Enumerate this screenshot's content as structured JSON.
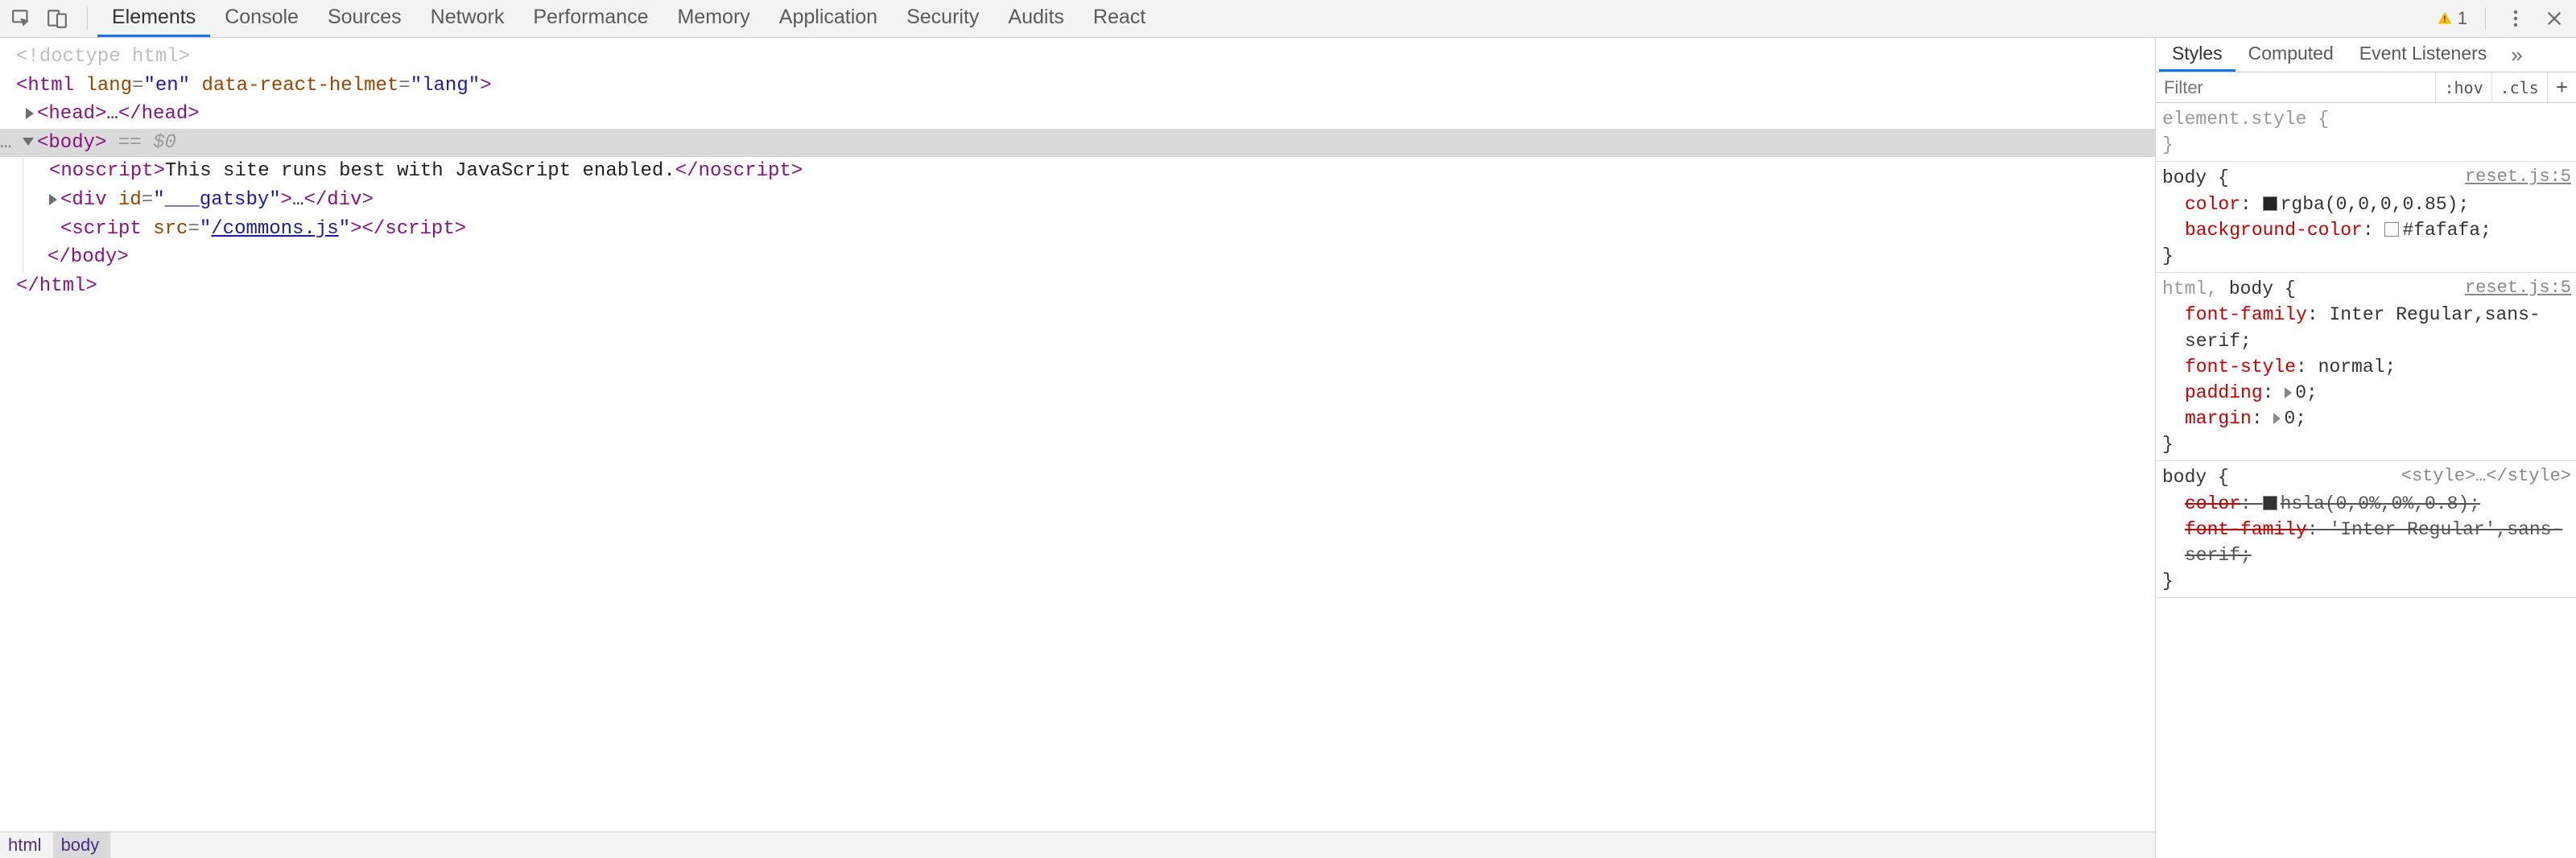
{
  "toolbar": {
    "tabs": [
      "Elements",
      "Console",
      "Sources",
      "Network",
      "Performance",
      "Memory",
      "Application",
      "Security",
      "Audits",
      "React"
    ],
    "active_tab": 0,
    "warning_count": "1"
  },
  "dom": {
    "doctype": "<!doctype html>",
    "html_open": {
      "tag": "html",
      "attrs": [
        [
          "lang",
          "en"
        ],
        [
          "data-react-helmet",
          "lang"
        ]
      ]
    },
    "head": {
      "tag": "head"
    },
    "body": {
      "tag": "body",
      "eq_expr": "== $0"
    },
    "noscript": {
      "tag": "noscript",
      "text": "This site runs best with JavaScript enabled."
    },
    "gatsby_div": {
      "tag": "div",
      "attrs": [
        [
          "id",
          "___gatsby"
        ]
      ]
    },
    "script": {
      "tag": "script",
      "attrs": [
        [
          "src",
          "/commons.js"
        ]
      ]
    },
    "body_close": "</body>",
    "html_close": "</html>",
    "breadcrumbs": [
      "html",
      "body"
    ]
  },
  "styles": {
    "tabs": [
      "Styles",
      "Computed",
      "Event Listeners"
    ],
    "active_tab": 0,
    "filter_placeholder": "Filter",
    "hov_label": ":hov",
    "cls_label": ".cls",
    "rules": [
      {
        "selector": "element.style",
        "source": "",
        "dim_selector": true,
        "props": []
      },
      {
        "selector": "body",
        "source": "reset.js:5",
        "props": [
          {
            "name": "color",
            "value": "rgba(0,0,0,0.85)",
            "swatch": "#000000d9"
          },
          {
            "name": "background-color",
            "value": "#fafafa",
            "swatch": "#fafafa"
          }
        ]
      },
      {
        "selector_dim": "html, ",
        "selector": "body",
        "source": "reset.js:5",
        "props": [
          {
            "name": "font-family",
            "value": "Inter Regular,sans-serif"
          },
          {
            "name": "font-style",
            "value": "normal"
          },
          {
            "name": "padding",
            "value": "0",
            "expandable": true
          },
          {
            "name": "margin",
            "value": "0",
            "expandable": true
          }
        ]
      },
      {
        "selector": "body",
        "source": "<style>…</style>",
        "source_nolink": true,
        "props": [
          {
            "name": "color",
            "value": "hsla(0,0%,0%,0.8)",
            "swatch": "#000000cc",
            "strike": true
          },
          {
            "name": "font-family",
            "value": "'Inter Regular',sans-serif",
            "strike": true
          }
        ]
      }
    ]
  }
}
